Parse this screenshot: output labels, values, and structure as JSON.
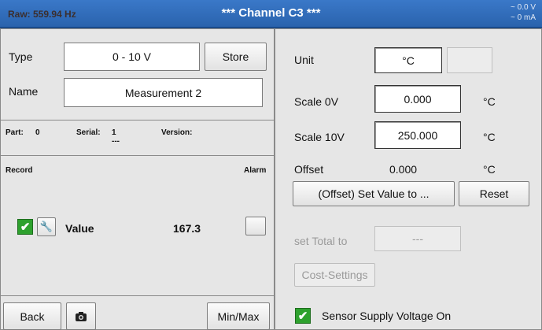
{
  "header": {
    "raw": "Raw: 559.94  Hz",
    "title": "***   Channel C3   ***",
    "voltage": "~ 0.0 V",
    "current": "~ 0 mA"
  },
  "left": {
    "type_label": "Type",
    "type_value": "0 - 10 V",
    "store_label": "Store",
    "name_label": "Name",
    "name_value": "Measurement 2",
    "part_label": "Part:",
    "part_value": "0",
    "serial_label": "Serial:",
    "serial_value": "1",
    "serial_sub": "---",
    "version_label": "Version:",
    "record_label": "Record",
    "alarm_label": "Alarm",
    "value_label": "Value",
    "value_number": "167.3"
  },
  "right": {
    "unit_label": "Unit",
    "unit_value": "°C",
    "unit_extra": "",
    "scale0_label": "Scale 0V",
    "scale0_value": "0.000",
    "scale0_unit": "°C",
    "scale10_label": "Scale 10V",
    "scale10_value": "250.000",
    "scale10_unit": "°C",
    "offset_label": "Offset",
    "offset_value": "0.000",
    "offset_unit": "°C",
    "set_value_label": "(Offset) Set Value to ...",
    "reset_label": "Reset",
    "set_total_label": "set Total to",
    "set_total_value": "---",
    "cost_label": "Cost-Settings",
    "sensor_supply_label": "Sensor Supply Voltage On"
  },
  "footer": {
    "back_label": "Back",
    "minmax_label": "Min/Max"
  },
  "icons": {
    "camera": "camera-icon",
    "wrench": "wrench-icon",
    "check": "check-icon"
  },
  "colors": {
    "header": "#2a63ad",
    "check": "#2ea12e"
  }
}
